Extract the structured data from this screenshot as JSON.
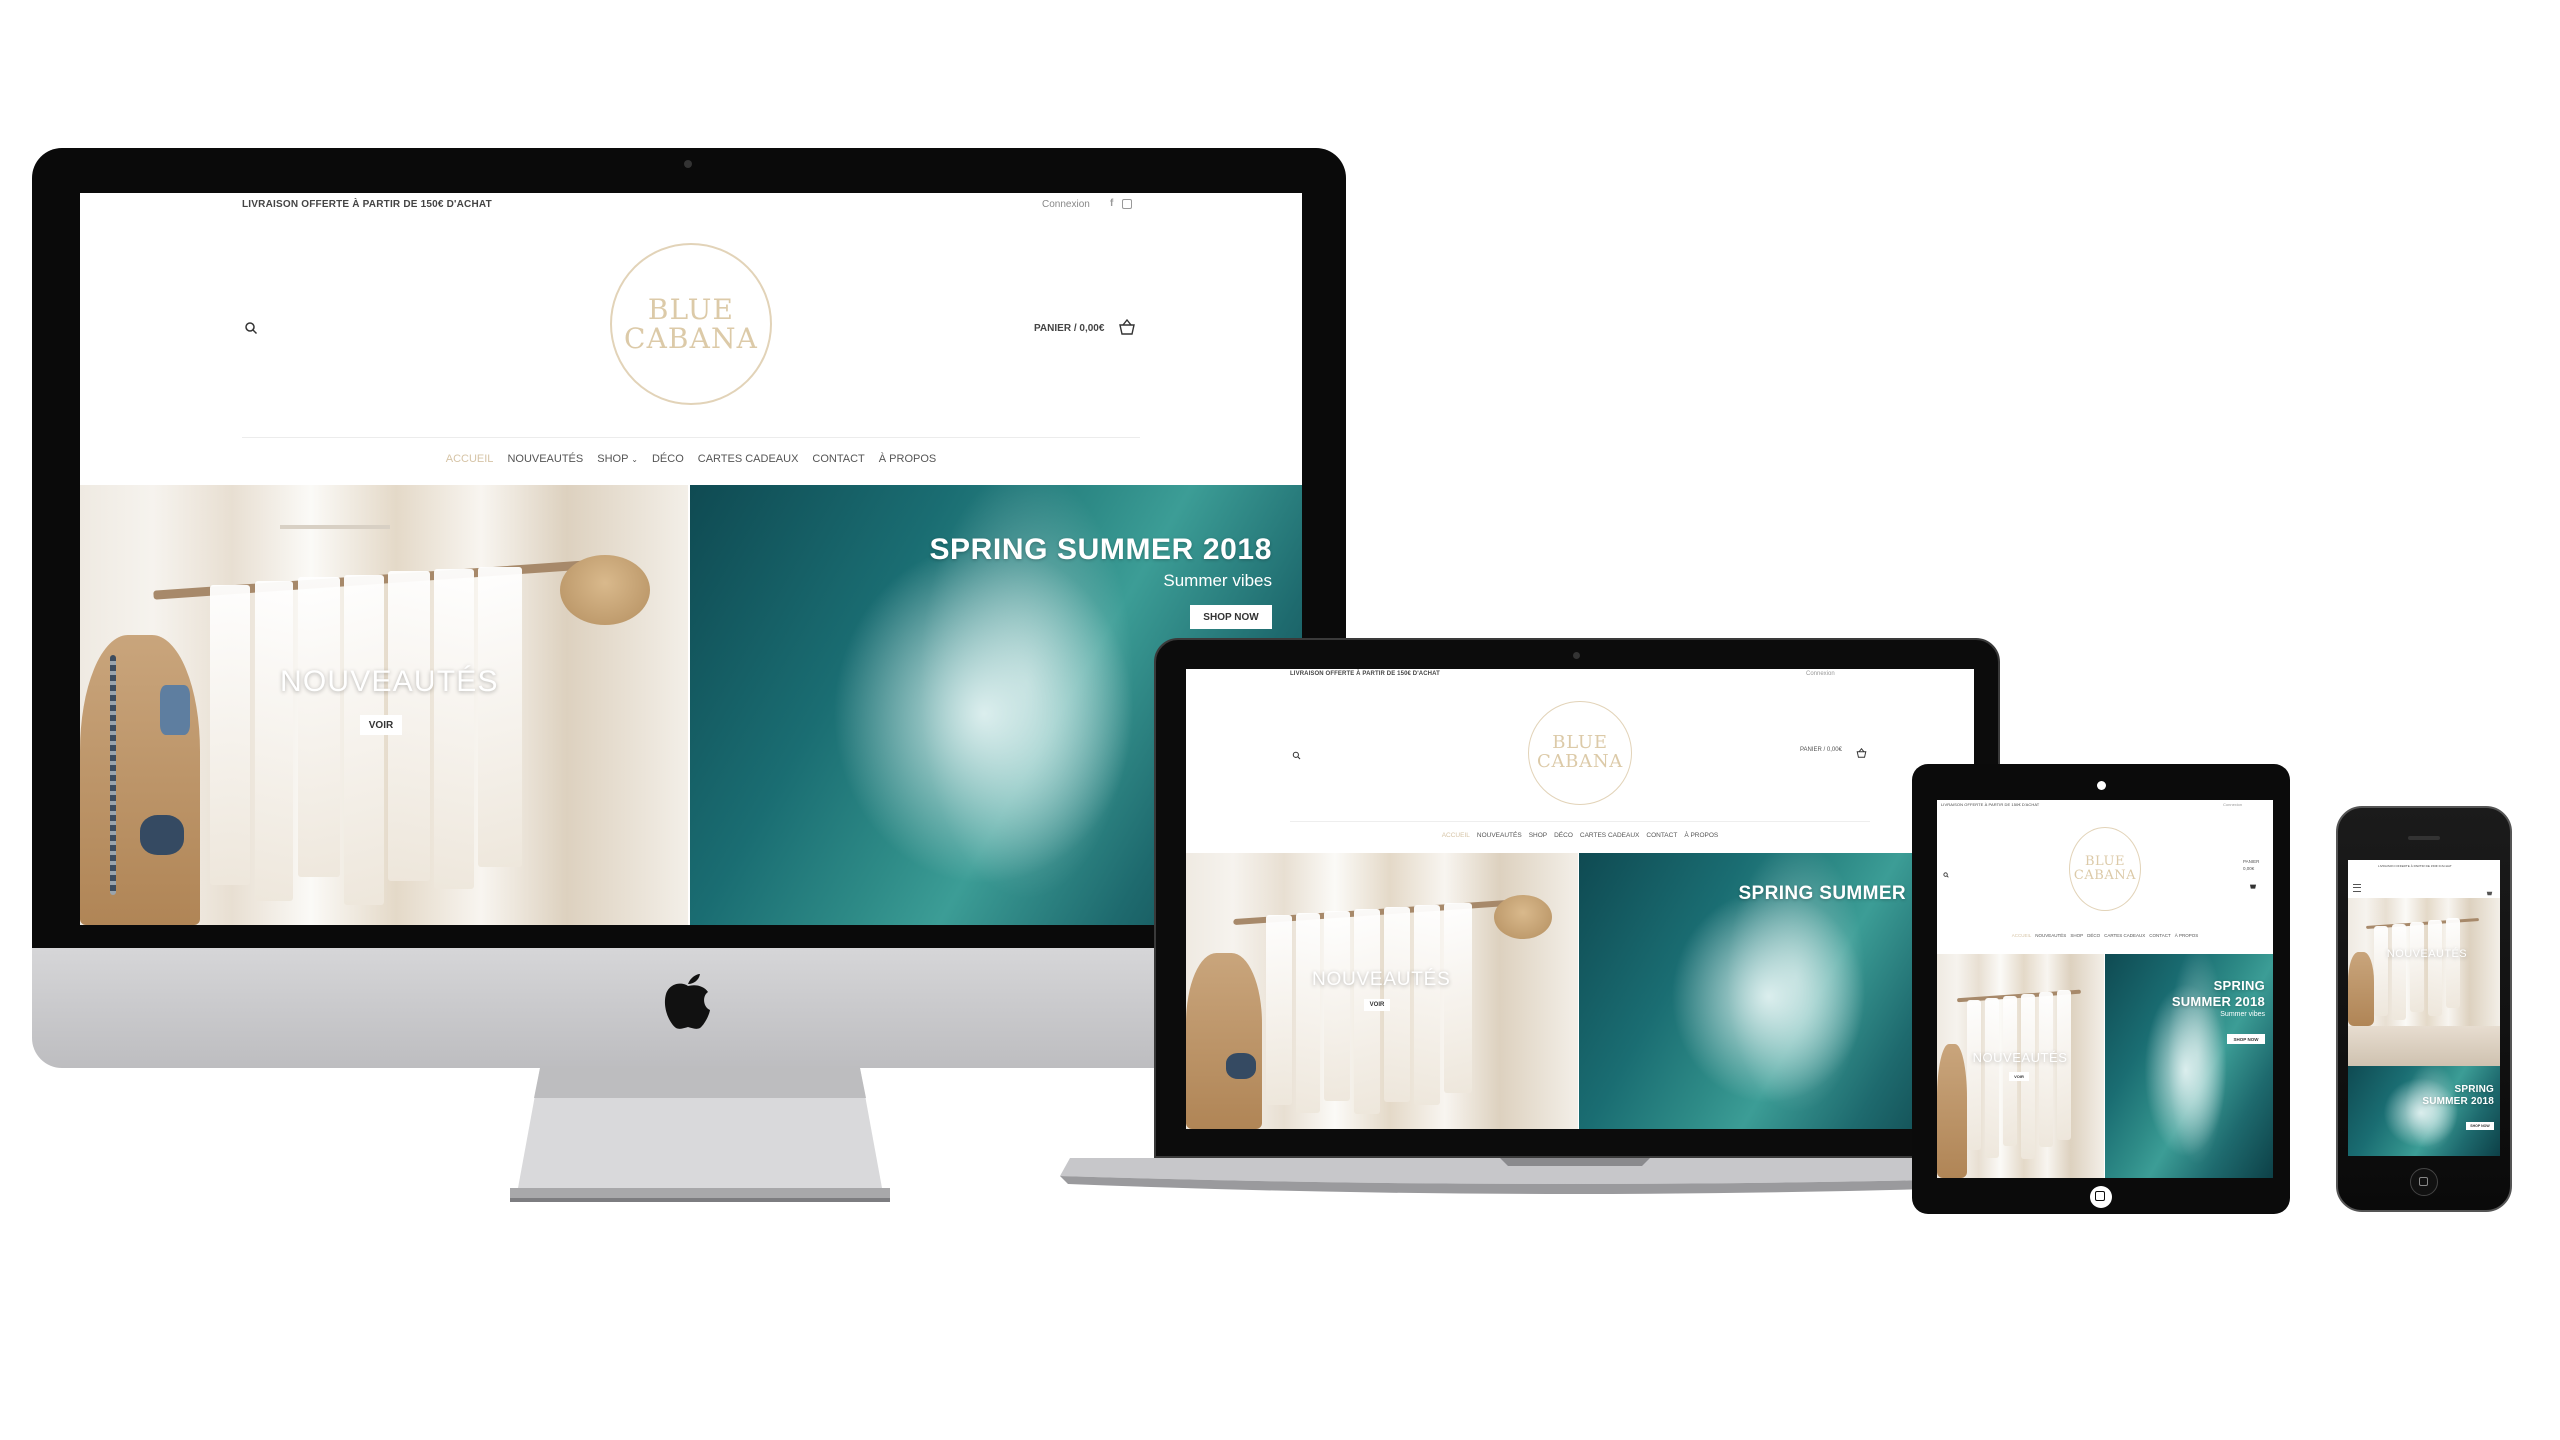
{
  "site": {
    "promo": "LIVRAISON OFFERTE À PARTIR DE 150€ D'ACHAT",
    "login": "Connexion",
    "logo_line1": "BLUE",
    "logo_line2": "CABANA",
    "cart": "PANIER / 0,00€",
    "cart_short": "PANIER",
    "cart_value": "0,00€"
  },
  "nav": {
    "home": "ACCUEIL",
    "new": "NOUVEAUTÉS",
    "shop": "SHOP",
    "deco": "DÉCO",
    "gift": "CARTES CADEAUX",
    "contact": "CONTACT",
    "about": "À PROPOS"
  },
  "slides": {
    "left_title": "NOUVEAUTÉS",
    "left_button": "VOIR",
    "right_title": "SPRING SUMMER 2018",
    "right_title_line1": "SPRING",
    "right_title_line2": "SUMMER 2018",
    "right_title_short": "SPRING SUMMER",
    "right_subtitle": "Summer vibes",
    "right_button": "SHOP NOW"
  },
  "colors": {
    "accent_gold": "#d6c4a6",
    "ocean": "#1a6d72",
    "device_black": "#0b0b0b",
    "aluminium": "#c9c9cb"
  }
}
